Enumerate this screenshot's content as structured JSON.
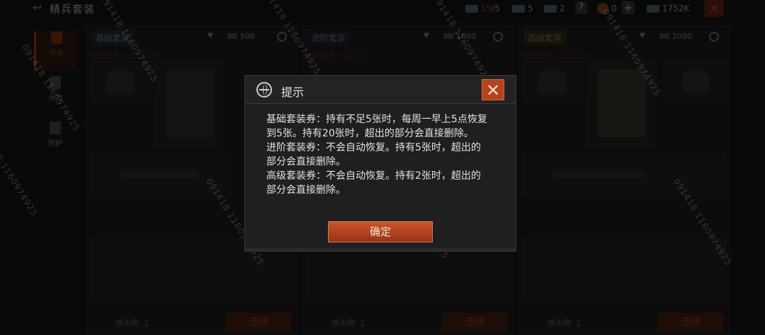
{
  "header": {
    "title": "精兵套装",
    "resources": [
      {
        "name": "basic-ticket",
        "value": "19",
        "max": "/5"
      },
      {
        "name": "advanced-ticket",
        "value": "5"
      },
      {
        "name": "premium-ticket",
        "value": "2"
      },
      {
        "name": "coin",
        "value": "0"
      },
      {
        "name": "currency",
        "value": "1752K"
      }
    ],
    "help_label": "?"
  },
  "side_tabs": [
    "突击",
    "火力",
    "防护"
  ],
  "panels": [
    {
      "name": "基础套装",
      "cost": "500",
      "value": "套装价值 [ 300000 ]"
    },
    {
      "name": "进阶套装",
      "cost": "1000",
      "value": "套装价值 [ 70000 ]"
    },
    {
      "name": "高级套装",
      "cost": "2000",
      "value": "套装价值 [ 100000 ]"
    }
  ],
  "use_fee_label": "使用费:",
  "use_fee_value": "1",
  "select_label": "选择",
  "dialog": {
    "title": "提示",
    "lines": [
      "基础套装券：持有不足5张时，每周一早上5点恢复",
      "到5张。持有20张时，超出的部分会直接删除。",
      "进阶套装券：不会自动恢复。持有5张时，超出的",
      "部分会直接删除。",
      "高级套装券：不会自动恢复。持有2张时，超出的",
      "部分会直接删除。"
    ],
    "confirm_label": "确定"
  },
  "watermark": "091418 1160974925"
}
